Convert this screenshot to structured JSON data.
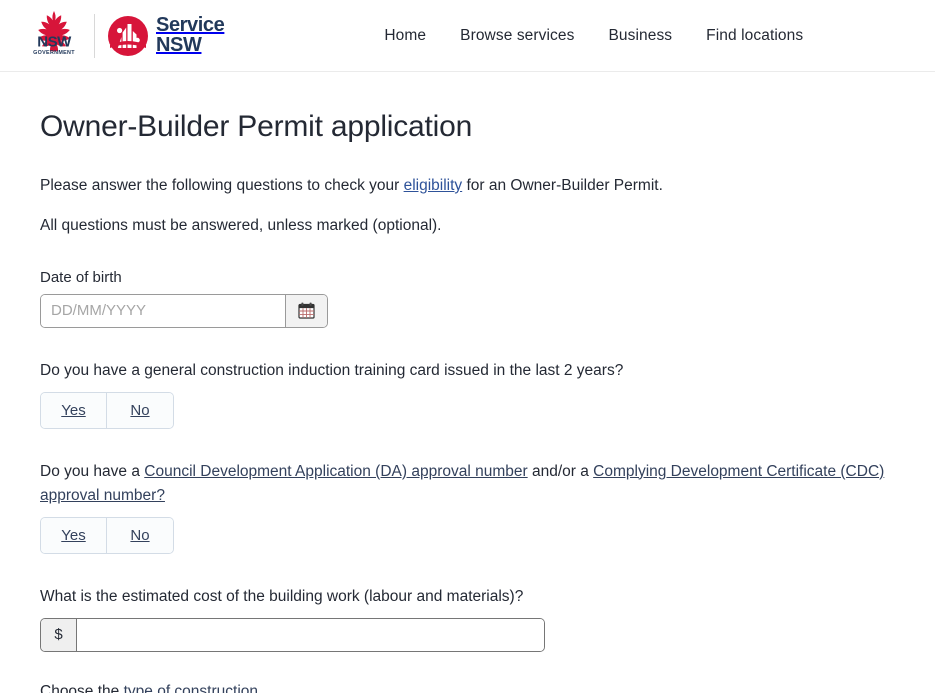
{
  "header": {
    "logo_primary_name": "nsw-government-logo",
    "logo_primary_text_main": "NSW",
    "logo_primary_text_sub": "GOVERNMENT",
    "logo_secondary_name": "service-nsw-logo",
    "logo_secondary_line1": "Service",
    "logo_secondary_line2": "NSW",
    "nav": [
      {
        "label": "Home",
        "name": "nav-home"
      },
      {
        "label": "Browse services",
        "name": "nav-browse-services"
      },
      {
        "label": "Business",
        "name": "nav-business"
      },
      {
        "label": "Find locations",
        "name": "nav-find-locations"
      }
    ]
  },
  "main": {
    "title": "Owner-Builder Permit application",
    "intro_1_before": "Please answer the following questions to check your ",
    "intro_1_link": "eligibility",
    "intro_1_after": " for an Owner-Builder Permit.",
    "intro_2": "All questions must be answered, unless marked (optional).",
    "date_of_birth": {
      "label": "Date of birth",
      "placeholder": "DD/MM/YYYY",
      "value": "",
      "calendar_icon": "calendar-icon"
    },
    "question_1": {
      "text": "Do you have a general construction induction training card issued in the last 2 years?",
      "yes_label": "Yes",
      "no_label": "No"
    },
    "question_2": {
      "text_before": "Do you have a ",
      "link_1": "Council Development Application (DA) approval number",
      "text_middle": " and/or a ",
      "link_2": "Complying Development Certificate (CDC) approval number?",
      "yes_label": "Yes",
      "no_label": "No"
    },
    "question_3": {
      "text": "What is the estimated cost of the building work (labour and materials)?",
      "currency_prefix": "$",
      "value": "",
      "placeholder": ""
    },
    "closing_before": "Choose the ",
    "closing_link": "type of construction"
  },
  "colors": {
    "brand_red": "#d7153a",
    "brand_navy": "#22395b",
    "link_blue": "#2e5299",
    "text": "#242934"
  }
}
